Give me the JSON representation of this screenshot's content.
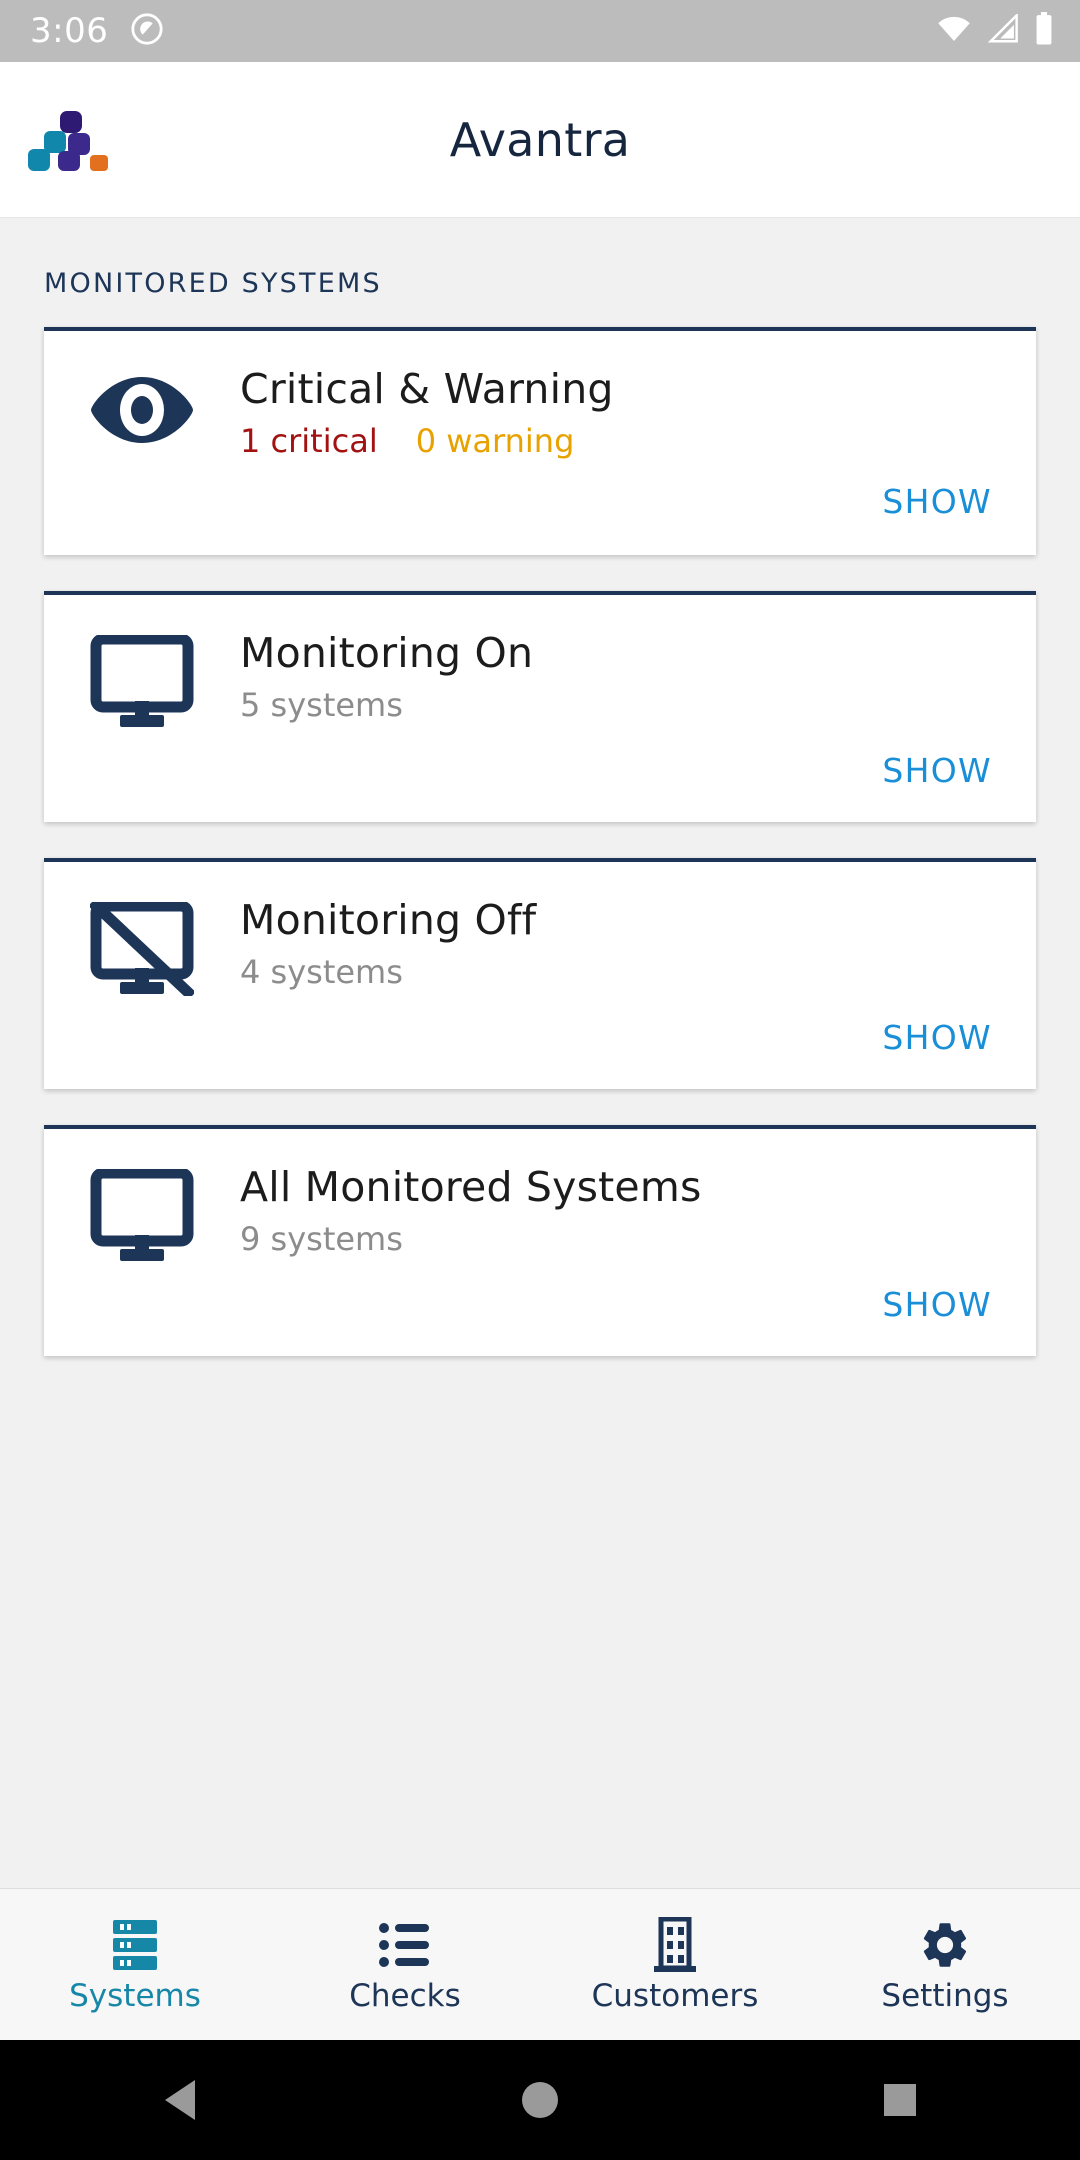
{
  "status_bar": {
    "time": "3:06",
    "icons": {
      "screen_record": "screen-record-icon",
      "wifi": "wifi-icon",
      "cellular": "cellular-signal-icon",
      "battery": "battery-full-icon"
    }
  },
  "header": {
    "title": "Avantra",
    "logo_name": "avantra-logo",
    "logo_colors": {
      "purple": "#2e1a73",
      "teal": "#1087ab",
      "orange": "#e2701e",
      "indigo": "#3b2a8c"
    }
  },
  "main": {
    "section_label": "MONITORED SYSTEMS",
    "cards": [
      {
        "icon": "eye-icon",
        "title": "Critical & Warning",
        "critical_text": "1 critical",
        "warning_text": "0 warning",
        "action_label": "SHOW"
      },
      {
        "icon": "monitor-icon",
        "title": "Monitoring On",
        "subtitle": "5 systems",
        "action_label": "SHOW"
      },
      {
        "icon": "monitor-off-icon",
        "title": "Monitoring Off",
        "subtitle": "4 systems",
        "action_label": "SHOW"
      },
      {
        "icon": "monitor-icon",
        "title": "All Monitored Systems",
        "subtitle": "9 systems",
        "action_label": "SHOW"
      }
    ]
  },
  "bottom_nav": {
    "items": [
      {
        "label": "Systems",
        "icon": "server-stack-icon",
        "active": true
      },
      {
        "label": "Checks",
        "icon": "list-icon",
        "active": false
      },
      {
        "label": "Customers",
        "icon": "building-icon",
        "active": false
      },
      {
        "label": "Settings",
        "icon": "gear-icon",
        "active": false
      }
    ]
  },
  "android_nav": {
    "back": "back-triangle-icon",
    "home": "home-circle-icon",
    "recents": "recents-square-icon"
  },
  "colors": {
    "navy": "#1d3557",
    "link_blue": "#1a8fd8",
    "active_teal": "#1787a8",
    "critical_red": "#a31212",
    "warning_amber": "#e8a200",
    "status_bar_gray": "#bcbcbc",
    "page_bg": "#f1f1f1"
  }
}
